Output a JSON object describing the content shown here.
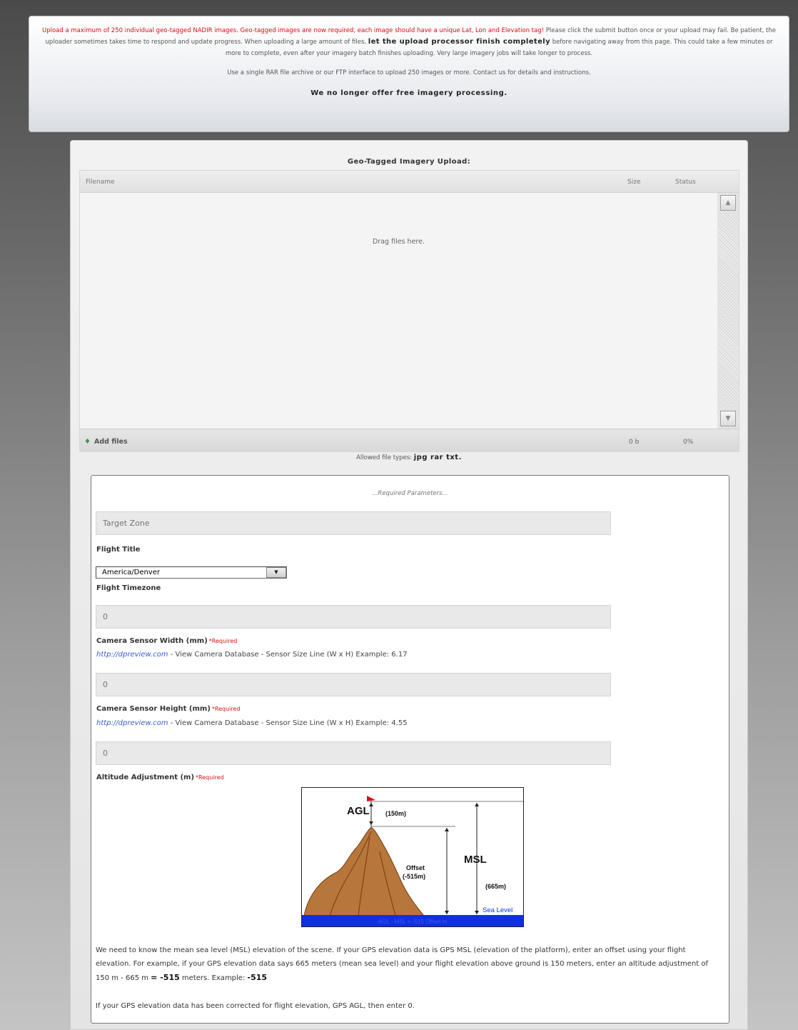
{
  "notice": {
    "red_text": "Upload a maximum of 250 individual geo-tagged NADIR images. Geo-tagged images are now required, each image should have a unique Lat, Lon and Elevation tag!",
    "text1": " Please click the submit button once or your upload may fail. Be patient, the uploader sometimes takes time to respond and update progress. When uploading a large amount of files, ",
    "bold_text": "let the upload processor finish completely",
    "text2": " before navigating away from this page. This could take a few minutes or more to complete, even after your imagery batch finishes uploading. Very large imagery jobs will take longer to process.",
    "rar_text": "Use a single RAR file archive or our FTP interface to upload 250 images or more. Contact us for details and instructions.",
    "no_free": "We no longer offer free imagery processing."
  },
  "uploader": {
    "title": "Geo-Tagged Imagery Upload:",
    "col_filename": "Filename",
    "col_size": "Size",
    "col_status": "Status",
    "drop_text": "Drag files here.",
    "add_files": "Add files",
    "total_size": "0 b",
    "total_status": "0%",
    "allowed_label": "Allowed file types:",
    "allowed_types": "jpg rar txt."
  },
  "params": {
    "title": "...Required Parameters...",
    "target_zone_placeholder": "Target Zone",
    "flight_title_label": "Flight Title",
    "timezone_value": "America/Denver",
    "timezone_label": "Flight Timezone",
    "sensor_width_value": "0",
    "sensor_width_label": "Camera Sensor Width (mm)",
    "required": "*Required",
    "dpreview_link": "http://dpreview.com",
    "sensor_width_hint": " - View Camera Database - Sensor Size Line (W x H) Example: 6.17",
    "sensor_height_value": "0",
    "sensor_height_label": "Camera Sensor Height (mm)",
    "sensor_height_hint": " - View Camera Database - Sensor Size Line (W x H) Example: 4.55",
    "altitude_value": "0",
    "altitude_label": "Altitude Adjustment (m)",
    "diagram": {
      "agl": "AGL",
      "agl_value": "(150m)",
      "offset": "Offset",
      "offset_value": "(-515m)",
      "msl": "MSL",
      "msl_value": "(665m)",
      "sea_level": "Sea Level",
      "formula": "AGL - MSL = -515 Offset m"
    },
    "msl_explain_1": "We need to know the mean sea level (MSL) elevation of the scene. If your GPS elevation data is GPS MSL (elevation of the platform), enter an offset using your flight elevation. For example, if your GPS elevation data says 665 meters (mean sea level) and your flight elevation above ground is 150 meters, enter an altitude adjustment of 150 m - 665 m ",
    "msl_explain_eq": "= -515",
    "msl_explain_2": " meters. Example: ",
    "msl_example": "-515",
    "agl_explain": "If your GPS elevation data has been corrected for flight elevation, GPS AGL, then enter 0."
  },
  "colors": {
    "notice_red": "#d81010",
    "link_blue": "#3a5fc0",
    "sea_blue": "#1030e0"
  }
}
